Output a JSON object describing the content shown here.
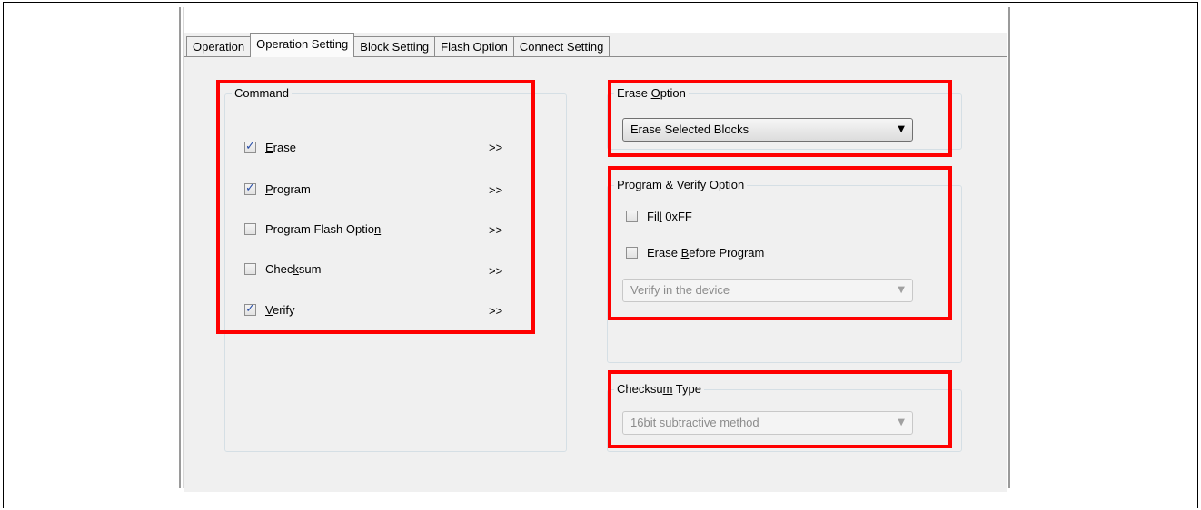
{
  "tabs": [
    {
      "label": "Operation"
    },
    {
      "label": "Operation Setting"
    },
    {
      "label": "Block Setting"
    },
    {
      "label": "Flash Option"
    },
    {
      "label": "Connect Setting"
    }
  ],
  "command": {
    "title": "Command",
    "items": [
      {
        "pre": "",
        "u": "E",
        "post": "rase",
        "checked": true,
        "arrow": ">>"
      },
      {
        "pre": "",
        "u": "P",
        "post": "rogram",
        "checked": true,
        "arrow": ">>"
      },
      {
        "pre": "Program Flash Optio",
        "u": "n",
        "post": "",
        "checked": false,
        "arrow": ">>"
      },
      {
        "pre": "Chec",
        "u": "k",
        "post": "sum",
        "checked": false,
        "arrow": ">>"
      },
      {
        "pre": "",
        "u": "V",
        "post": "erify",
        "checked": true,
        "arrow": ">>"
      }
    ]
  },
  "erase_option": {
    "title_pre": "Erase ",
    "title_u": "O",
    "title_post": "ption",
    "selected": "Erase Selected Blocks"
  },
  "program_verify": {
    "title": "Program & Verify Option",
    "fill": {
      "pre": "Fil",
      "u": "l",
      "post": " 0xFF",
      "checked": false
    },
    "erase_before": {
      "pre": "Erase ",
      "u": "B",
      "post": "efore Program",
      "checked": false
    },
    "verify_selected": "Verify in the device"
  },
  "checksum_type": {
    "title_pre": "Checksu",
    "title_u": "m",
    "title_post": " Type",
    "selected": "16bit subtractive method"
  },
  "icons": {
    "dropdown": "▼"
  }
}
